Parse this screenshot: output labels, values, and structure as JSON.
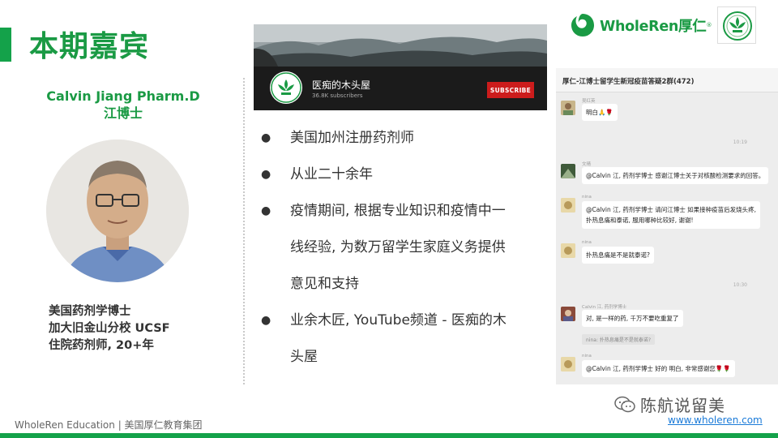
{
  "slide": {
    "title": "本期嘉宾",
    "guest_name_en": "Calvin Jiang Pharm.D",
    "guest_name_cn": "江博士",
    "bio": [
      "美国药剂学博士",
      "加大旧金山分校 UCSF",
      "住院药剂师, 20+年"
    ],
    "bullets": [
      {
        "lines": [
          "美国加州注册药剂师"
        ]
      },
      {
        "lines": [
          "从业二十余年"
        ]
      },
      {
        "lines": [
          "疫情期间, 根据专业知识和疫情中一",
          "线经验, 为数万留学生家庭义务提供",
          "意见和支持"
        ]
      },
      {
        "lines": [
          "业余木匠, YouTube频道 - 医痴的木",
          "头屋"
        ]
      }
    ]
  },
  "youtube": {
    "channel_name": "医痴的木头屋",
    "subscribers": "36.8K subscribers",
    "subscribe_label": "SUBSCRIBE"
  },
  "brand": {
    "name": "WholeRen厚仁",
    "reg": "®"
  },
  "chat": {
    "group_title": "厚仁-江博士留学生新冠疫苗答疑2群(472)",
    "times": [
      "10:19",
      "10:30"
    ],
    "messages": [
      {
        "sender": "吴红英",
        "text": "明白🙏🌹"
      },
      {
        "sender": "文晴",
        "text": "@Calvin 江, 药剂学博士 感谢江博士关于对核酸检测要求的回答。"
      },
      {
        "sender": "nina",
        "text": "@Calvin 江, 药剂学博士 请问江博士 如果接种疫苗后发烧头疼,",
        "text2": "扑热息痛和泰诺, 服用哪种比较好, 谢谢!"
      },
      {
        "sender": "nina",
        "text": "扑热息痛是不是就泰诺?"
      },
      {
        "sender": "Calvin 江, 药剂学博士",
        "text": "对, 是一样的药, 千万不要吃重复了",
        "quote": "nina: 扑热息痛是不是就泰诺?"
      },
      {
        "sender": "nina",
        "text": "@Calvin 江, 药剂学博士 好的 明白, 非常感谢您🌹🌹"
      }
    ]
  },
  "footer": {
    "left": "WholeRen Education | 美国厚仁教育集团",
    "wechat": "陈航说留美",
    "site": "www.wholeren.com"
  },
  "colors": {
    "brand_green": "#1a9a44",
    "subscribe_red": "#cc1c1c",
    "link_blue": "#1a7ad8"
  }
}
